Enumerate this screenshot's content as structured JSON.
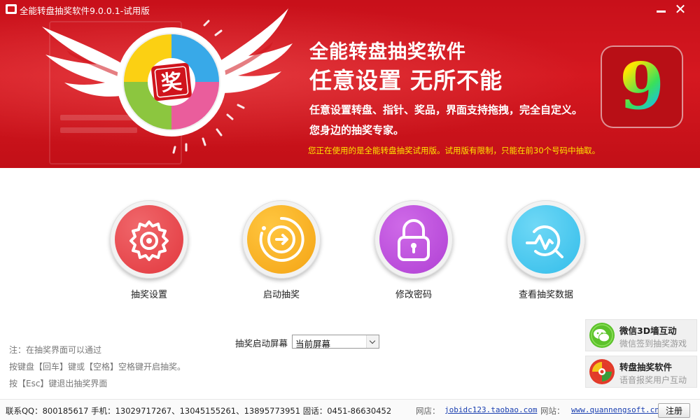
{
  "window": {
    "title": "全能转盘抽奖软件9.0.0.1-试用版",
    "min_icon": "minimize-icon",
    "close_icon": "close-icon",
    "close_glyph": "✕"
  },
  "banner": {
    "headline_1": "全能转盘抽奖软件",
    "headline_2": "任意设置  无所不能",
    "tagline_1": "任意设置转盘、指针、奖品，界面支持拖拽，完全自定义。",
    "tagline_2": "您身边的抽奖专家。",
    "trial_notice": "您正在使用的是全能转盘抽奖试用版。试用版有限制，只能在前30个号码中抽取。",
    "logo_char": "奖",
    "version_digit": "9",
    "colors": {
      "banner_red": "#d0141c",
      "notice_yellow": "#ffe600"
    }
  },
  "actions": [
    {
      "label": "抽奖设置",
      "icon": "gear-icon",
      "color": "#e8444a"
    },
    {
      "label": "启动抽奖",
      "icon": "play-circle-icon",
      "color": "#f7ad1f"
    },
    {
      "label": "修改密码",
      "icon": "lock-icon",
      "color": "#b84ad8"
    },
    {
      "label": "查看抽奖数据",
      "icon": "chart-magnifier-icon",
      "color": "#3ec4ef"
    }
  ],
  "screen": {
    "label": "抽奖启动屏幕",
    "selected": "当前屏幕"
  },
  "notes": [
    "注：在抽奖界面可以通过",
    "按键盘【回车】键或【空格】空格键开启抽奖。",
    "按【Esc】键退出抽奖界面"
  ],
  "promos": [
    {
      "title": "微信3D墙互动",
      "subtitle": "微信签到抽奖游戏",
      "icon": "wechat-icon",
      "color": "#5cc22b"
    },
    {
      "title": "转盘抽奖软件",
      "subtitle": "语音报奖用户互动",
      "icon": "wheel-icon",
      "color": "#e23a2a"
    }
  ],
  "footer": {
    "contact": "联系QQ：800185617  手机：13029717267、13045155261、13895773951  固话：0451-86630452",
    "shop_label": "网店：",
    "shop_link": "jobidc123.taobao.com",
    "site_label": "网站：",
    "site_link": "www.quannengsoft.cn",
    "register_label": "注册"
  }
}
